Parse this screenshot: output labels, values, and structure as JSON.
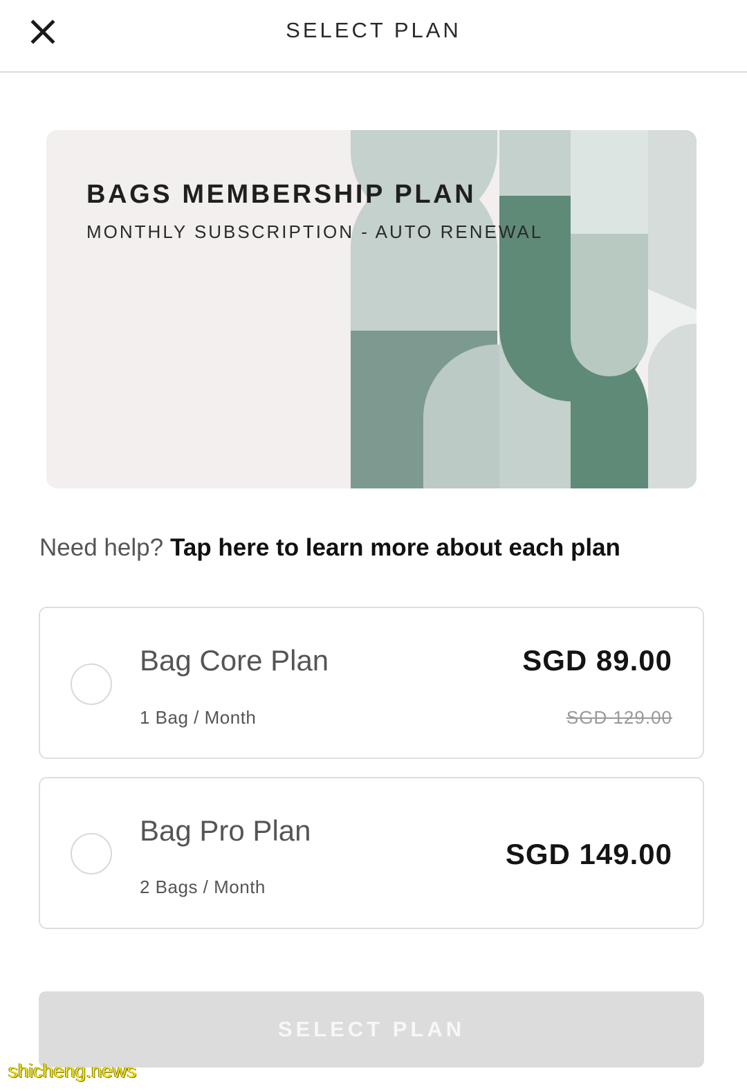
{
  "header": {
    "title": "SELECT PLAN",
    "close_icon": "close-icon"
  },
  "hero": {
    "title": "BAGS MEMBERSHIP PLAN",
    "subtitle": "MONTHLY SUBSCRIPTION - AUTO RENEWAL",
    "colors": {
      "background": "#f2efee",
      "light": "#c4d1cc",
      "mid": "#7c9a90",
      "dark": "#5f8a78",
      "pale": "#d5dcd9"
    }
  },
  "help": {
    "prefix": "Need help?",
    "link": "Tap here to learn more about each plan"
  },
  "plans": [
    {
      "name": "Bag Core Plan",
      "description": "1 Bag / Month",
      "price": "SGD 89.00",
      "original_price": "SGD 129.00",
      "selected": false
    },
    {
      "name": "Bag Pro Plan",
      "description": "2 Bags / Month",
      "price": "SGD 149.00",
      "selected": false
    }
  ],
  "actions": {
    "select_label": "SELECT PLAN",
    "disabled": true
  },
  "watermark": "shicheng.news"
}
